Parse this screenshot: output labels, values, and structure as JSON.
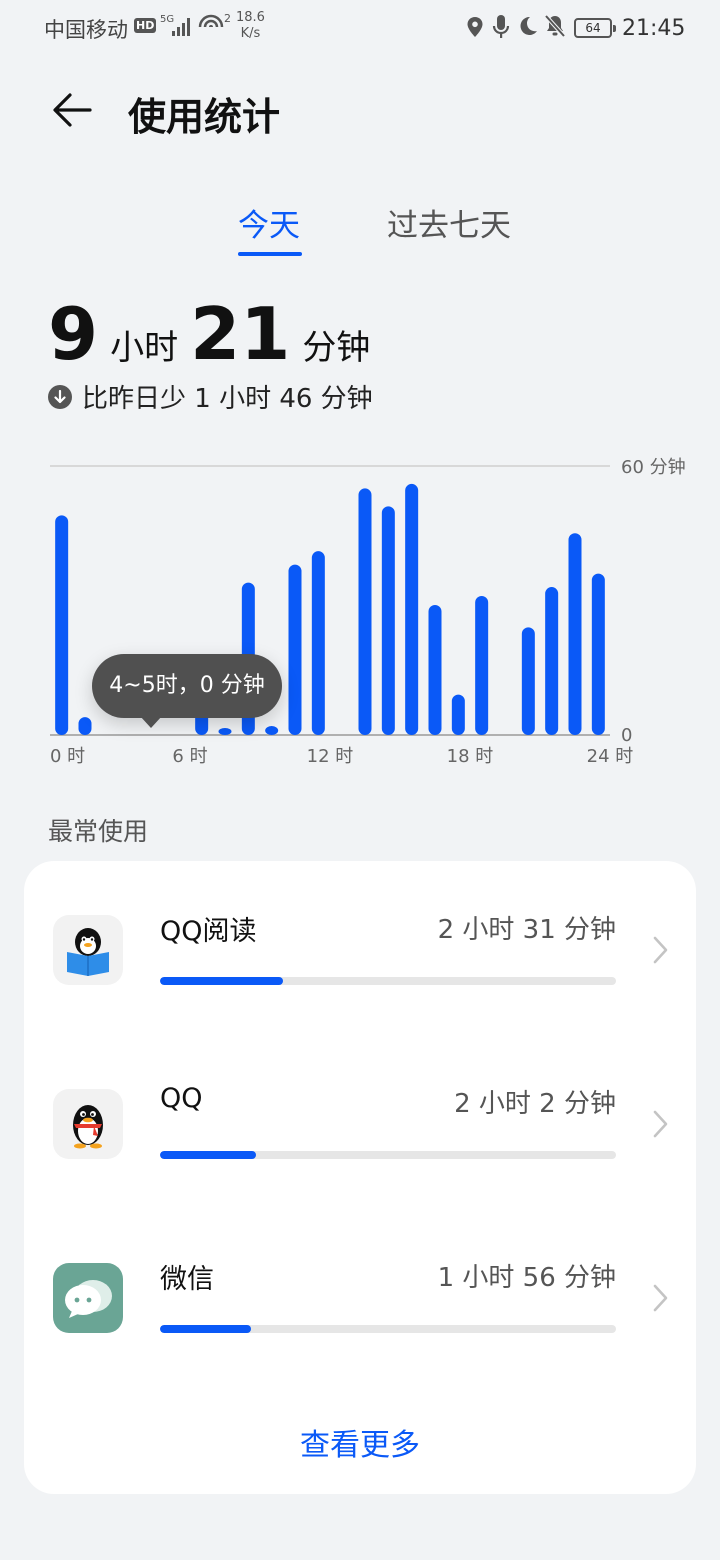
{
  "status_bar": {
    "carrier": "中国移动",
    "hd": "HD",
    "network": "5G",
    "wifi_sub": "2",
    "speed_value": "18.6",
    "speed_unit": "K/s",
    "battery": "64",
    "time": "21:45",
    "icons": [
      "location-icon",
      "mic-icon",
      "moon-icon",
      "bell-off-icon",
      "battery-icon"
    ]
  },
  "header": {
    "title": "使用统计",
    "back_icon": "arrow-left-icon"
  },
  "tabs": [
    {
      "label": "今天",
      "selected": true
    },
    {
      "label": "过去七天",
      "selected": false
    }
  ],
  "total": {
    "hours": "9",
    "hours_unit": "小时",
    "minutes": "21",
    "minutes_unit": "分钟",
    "compare": "比昨日少 1 小时 46 分钟"
  },
  "chart_data": {
    "type": "bar",
    "x": [
      0,
      1,
      2,
      3,
      4,
      5,
      6,
      7,
      8,
      9,
      10,
      11,
      12,
      13,
      14,
      15,
      16,
      17,
      18,
      19,
      20,
      21,
      22,
      23
    ],
    "values": [
      49,
      4,
      0,
      0,
      0,
      0,
      6,
      1,
      34,
      2,
      38,
      41,
      0,
      55,
      51,
      56,
      29,
      9,
      31,
      0,
      24,
      33,
      45,
      36
    ],
    "ylim": [
      0,
      60
    ],
    "y_top_label": "60 分钟",
    "y_bottom_label": "0",
    "x_tick_labels": [
      "0 时",
      "6 时",
      "12 时",
      "18 时",
      "24 时"
    ],
    "x_tick_positions": [
      0,
      6,
      12,
      18,
      24
    ],
    "bar_color": "#0a59f7",
    "tooltip": "4~5时，0 分钟"
  },
  "section_title": "最常使用",
  "apps": [
    {
      "name": "QQ阅读",
      "time": "2 小时 31 分钟",
      "fraction": 0.27,
      "icon": "qq-reader-icon"
    },
    {
      "name": "QQ",
      "time": "2 小时 2 分钟",
      "fraction": 0.21,
      "icon": "qq-penguin-icon"
    },
    {
      "name": "微信",
      "time": "1 小时 56 分钟",
      "fraction": 0.2,
      "icon": "wechat-icon"
    }
  ],
  "more_label": "查看更多",
  "colors": {
    "accent": "#0a59f7",
    "background": "#f1f3f5",
    "card": "#ffffff"
  }
}
